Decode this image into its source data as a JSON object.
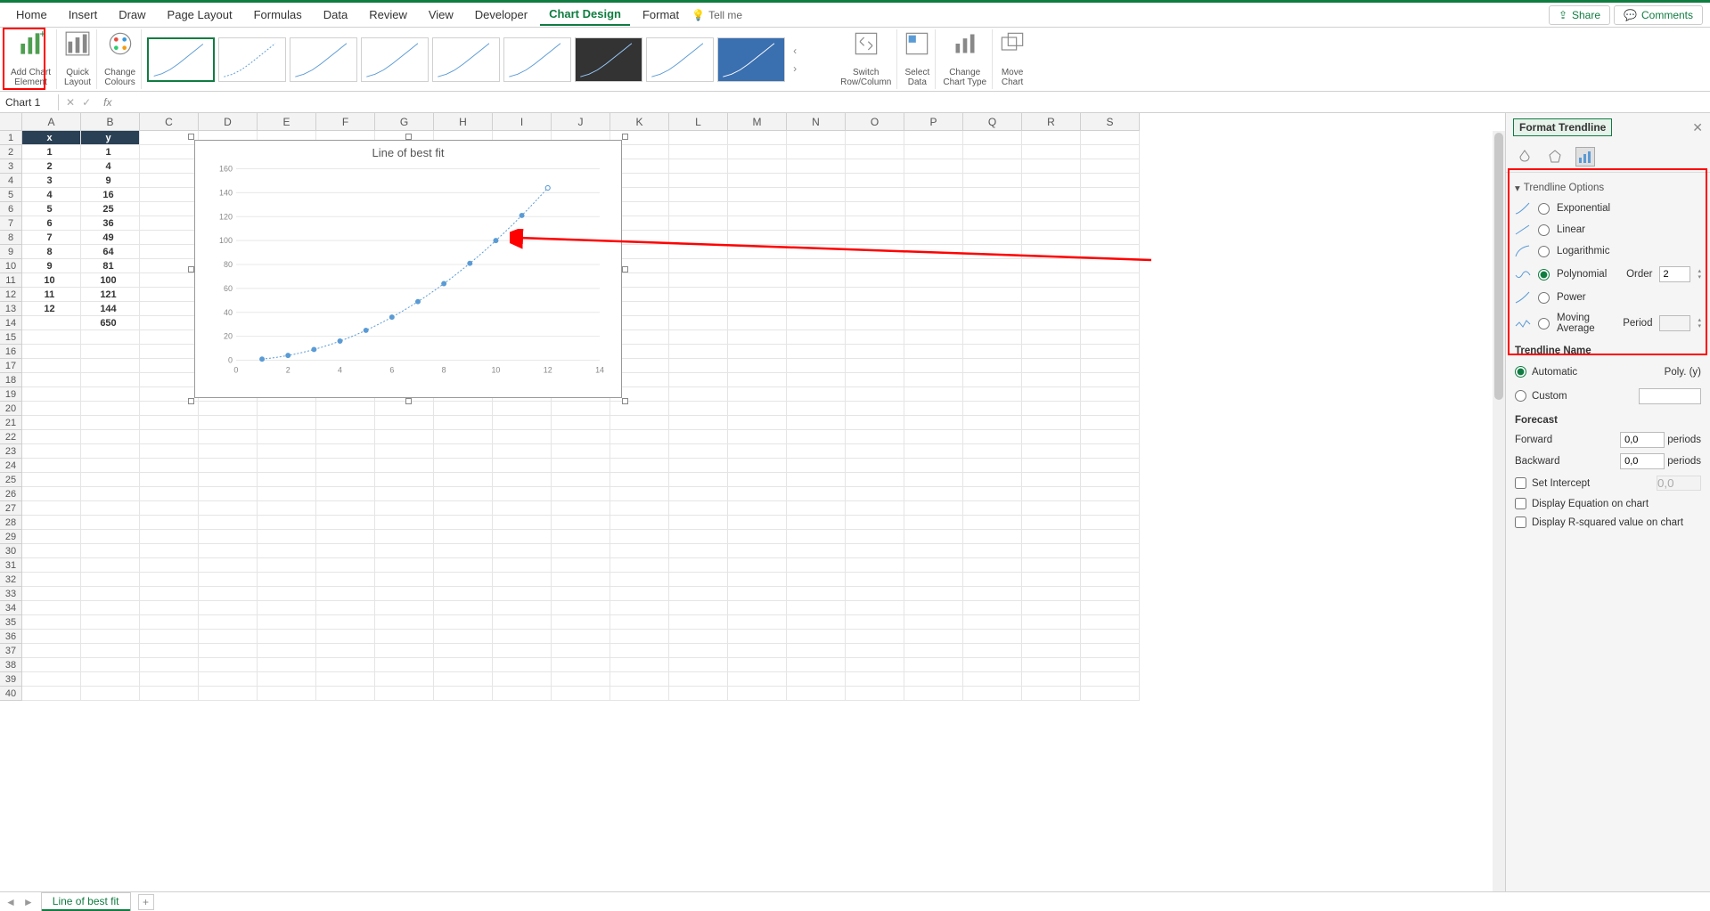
{
  "ribbon": {
    "tabs": [
      "Home",
      "Insert",
      "Draw",
      "Page Layout",
      "Formulas",
      "Data",
      "Review",
      "View",
      "Developer",
      "Chart Design",
      "Format"
    ],
    "active_tab": "Chart Design",
    "tellme": "Tell me",
    "share": "Share",
    "comments": "Comments",
    "groups": {
      "add_chart_element": "Add Chart\nElement",
      "quick_layout": "Quick\nLayout",
      "change_colours": "Change\nColours",
      "switch": "Switch\nRow/Column",
      "select_data": "Select\nData",
      "change_type": "Change\nChart Type",
      "move_chart": "Move\nChart"
    }
  },
  "namebox": "Chart 1",
  "columns": [
    "A",
    "B",
    "C",
    "D",
    "E",
    "F",
    "G",
    "H",
    "I",
    "J",
    "K",
    "L",
    "M",
    "N",
    "O",
    "P",
    "Q",
    "R",
    "S"
  ],
  "table": {
    "headers": {
      "x": "x",
      "y": "y"
    },
    "rows": [
      {
        "x": 1,
        "y": 1
      },
      {
        "x": 2,
        "y": 4
      },
      {
        "x": 3,
        "y": 9
      },
      {
        "x": 4,
        "y": 16
      },
      {
        "x": 5,
        "y": 25
      },
      {
        "x": 6,
        "y": 36
      },
      {
        "x": 7,
        "y": 49
      },
      {
        "x": 8,
        "y": 64
      },
      {
        "x": 9,
        "y": 81
      },
      {
        "x": 10,
        "y": 100
      },
      {
        "x": 11,
        "y": 121
      },
      {
        "x": 12,
        "y": 144
      }
    ],
    "sum_y": 650
  },
  "chart_data": {
    "type": "scatter",
    "title": "Line of best fit",
    "x": [
      1,
      2,
      3,
      4,
      5,
      6,
      7,
      8,
      9,
      10,
      11,
      12
    ],
    "y": [
      1,
      4,
      9,
      16,
      25,
      36,
      49,
      64,
      81,
      100,
      121,
      144
    ],
    "xlim": [
      0,
      14
    ],
    "ylim": [
      0,
      160
    ],
    "xticks": [
      0,
      2,
      4,
      6,
      8,
      10,
      12,
      14
    ],
    "yticks": [
      0,
      20,
      40,
      60,
      80,
      100,
      120,
      140,
      160
    ],
    "trendline": "polynomial",
    "trendline_order": 2
  },
  "panel": {
    "title": "Format Trendline",
    "section": "Trendline Options",
    "options": {
      "exponential": "Exponential",
      "linear": "Linear",
      "logarithmic": "Logarithmic",
      "polynomial": "Polynomial",
      "power": "Power",
      "moving_avg": "Moving Average"
    },
    "selected": "polynomial",
    "order_label": "Order",
    "order_value": "2",
    "period_label": "Period",
    "period_value": "",
    "trendline_name_section": "Trendline Name",
    "automatic_label": "Automatic",
    "automatic_value": "Poly. (y)",
    "custom_label": "Custom",
    "custom_value": "",
    "forecast_section": "Forecast",
    "forward_label": "Forward",
    "forward_value": "0,0",
    "backward_label": "Backward",
    "backward_value": "0,0",
    "periods_label": "periods",
    "set_intercept_label": "Set Intercept",
    "set_intercept_value": "0,0",
    "display_eq_label": "Display Equation on chart",
    "display_r2_label": "Display R-squared value on chart"
  },
  "sheet_tab": "Line of best fit"
}
